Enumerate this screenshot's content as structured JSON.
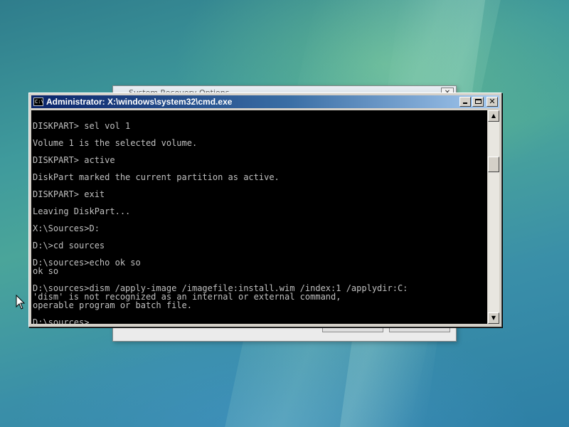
{
  "background_window": {
    "title": "System Recovery Options",
    "close_label": "✕"
  },
  "cmd_window": {
    "title": "Administrator: X:\\windows\\system32\\cmd.exe",
    "icon_label": "C:\\",
    "close_label": "✕",
    "console_lines": [
      "",
      "DISKPART> sel vol 1",
      "",
      "Volume 1 is the selected volume.",
      "",
      "DISKPART> active",
      "",
      "DiskPart marked the current partition as active.",
      "",
      "DISKPART> exit",
      "",
      "Leaving DiskPart...",
      "",
      "X:\\Sources>D:",
      "",
      "D:\\>cd sources",
      "",
      "D:\\sources>echo ok so",
      "ok so",
      "",
      "D:\\sources>dism /apply-image /imagefile:install.wim /index:1 /applydir:C:",
      "'dism' is not recognized as an internal or external command,",
      "operable program or batch file.",
      "",
      "D:\\sources>"
    ],
    "scroll_position": 0.2
  },
  "colors": {
    "console_bg": "#000000",
    "console_fg": "#c0c0c0",
    "titlebar_start": "#0a246a",
    "titlebar_end": "#a6caf0"
  }
}
